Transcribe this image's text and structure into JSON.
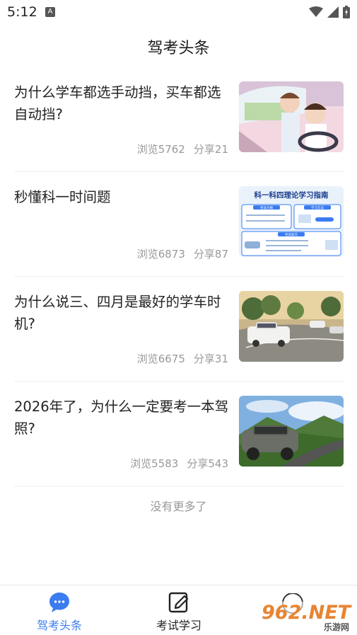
{
  "status_bar": {
    "time": "5:12",
    "app_icon_letter": "A"
  },
  "header": {
    "title": "驾考头条"
  },
  "articles": [
    {
      "title": "为什么学车都选手动挡，买车都选自动挡?",
      "views": "浏览5762",
      "shares": "分享21"
    },
    {
      "title": "秒懂科一时间题",
      "views": "浏览6873",
      "shares": "分享87",
      "thumb_text": {
        "title": "科一科四理论学习指南",
        "tag1": "考试大纲",
        "tag2": "学习方法",
        "tag3": "考试技巧"
      }
    },
    {
      "title": "为什么说三、四月是最好的学车时机?",
      "views": "浏览6675",
      "shares": "分享31"
    },
    {
      "title": "2026年了，为什么一定要考一本驾照?",
      "views": "浏览5583",
      "shares": "分享543"
    }
  ],
  "footer_note": "没有更多了",
  "bottom_nav": [
    {
      "label": "驾考头条",
      "icon": "chat-bubble-icon",
      "active": true
    },
    {
      "label": "考试学习",
      "icon": "edit-note-icon",
      "active": false
    }
  ],
  "watermark": {
    "text": "962.NET",
    "sub": "乐游网"
  },
  "colors": {
    "accent": "#3b7cf0",
    "muted": "#999999",
    "divider": "#eeeeee"
  }
}
